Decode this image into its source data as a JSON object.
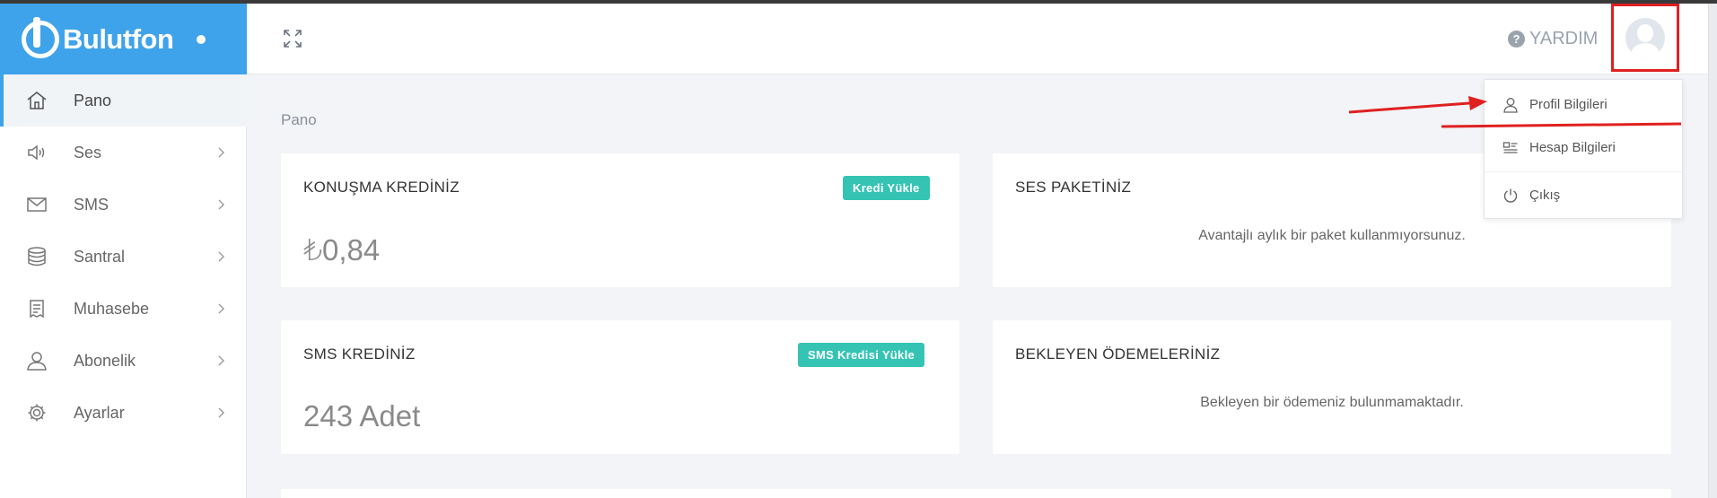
{
  "app": {
    "brand": "Bulutfon",
    "help_label": "YARDIM"
  },
  "sidebar": {
    "items": [
      {
        "label": "Pano",
        "icon": "home-icon",
        "active": true
      },
      {
        "label": "Ses",
        "icon": "speaker-icon"
      },
      {
        "label": "SMS",
        "icon": "envelope-icon"
      },
      {
        "label": "Santral",
        "icon": "database-icon"
      },
      {
        "label": "Muhasebe",
        "icon": "receipt-icon"
      },
      {
        "label": "Abonelik",
        "icon": "user-icon"
      },
      {
        "label": "Ayarlar",
        "icon": "gear-icon"
      }
    ]
  },
  "main": {
    "breadcrumb": "Pano",
    "cards": {
      "talk_credit": {
        "title": "KONUŞMA KREDİNİZ",
        "button": "Kredi Yükle",
        "value": "₺0,84"
      },
      "voice_package": {
        "title": "SES PAKETİNİZ",
        "message": "Avantajlı aylık bir paket kullanmıyorsunuz."
      },
      "sms_credit": {
        "title": "SMS KREDİNİZ",
        "button": "SMS Kredisi Yükle",
        "value": "243 Adet"
      },
      "pending_payments": {
        "title": "BEKLEYEN ÖDEMELERİNİZ",
        "message": "Bekleyen bir ödemeniz bulunmamaktadır."
      }
    }
  },
  "user_menu": {
    "items": [
      {
        "label": "Profil Bilgileri",
        "icon": "user-icon"
      },
      {
        "label": "Hesap Bilgileri",
        "icon": "id-card-icon"
      },
      {
        "label": "Çıkış",
        "icon": "power-icon"
      }
    ]
  },
  "colors": {
    "brand_blue": "#3ea3ea",
    "button_teal": "#35c3b4",
    "annotation_red": "#e02020"
  }
}
